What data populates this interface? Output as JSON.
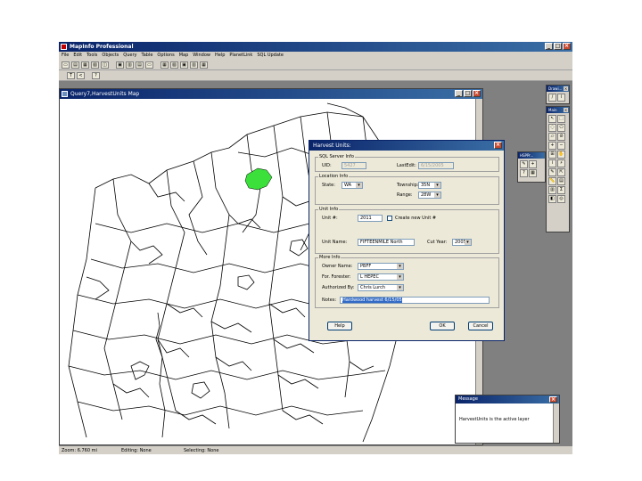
{
  "app": {
    "title": "MapInfo Professional"
  },
  "menu": [
    "File",
    "Edit",
    "Tools",
    "Objects",
    "Query",
    "Table",
    "Options",
    "Map",
    "Window",
    "Help",
    "PlanetLink",
    "SQL Update"
  ],
  "toolbar1": [
    "▭",
    "▤",
    "▦",
    "▧",
    "◫",
    "▣",
    "▥",
    "▤",
    "▭",
    "▦",
    "▧",
    "▣",
    "▥",
    "▦"
  ],
  "toolbar2": [
    "T",
    "<",
    "?"
  ],
  "map_window": {
    "title": "Query7,HarvestUnits Map"
  },
  "dialog": {
    "title": "Harvest Units:",
    "sql_group": "SQL Server Info",
    "uid_label": "UID:",
    "uid_value": "5427",
    "lastedit_label": "LastEdit:",
    "lastedit_value": "6/15/2005",
    "location_group": "Location Info",
    "state_label": "State:",
    "state_value": "WA",
    "township_label": "Township:",
    "township_value": "35N",
    "range_label": "Range:",
    "range_value": "28W",
    "unit_group": "Unit Info",
    "unitnum_label": "Unit #:",
    "unitnum_value": "2011",
    "checkbox_label": "Create new Unit #",
    "unitname_label": "Unit Name:",
    "unitname_value": "FIFTEENMILE North",
    "cutyear_label": "Cut Year:",
    "cutyear_value": "2005",
    "more_group": "More Info",
    "owner_label": "Owner Name:",
    "owner_value": "PBFF",
    "forester_label": "For. Forester:",
    "forester_value": "L HEPEC",
    "authorized_label": "Authorized By:",
    "authorized_value": "Chris Lurch",
    "notes_label": "Notes:",
    "notes_value": "Hardwood harvest 6/15/05",
    "help_btn": "Help",
    "ok_btn": "OK",
    "cancel_btn": "Cancel"
  },
  "palettes": {
    "drawing": "Drawi...",
    "main": "Main",
    "small": "HSPPr..."
  },
  "message": {
    "title": "Message",
    "text": "HarvestUnits is the active layer"
  },
  "status": {
    "zoom": "Zoom: 6.760 mi",
    "editing": "Editing: None",
    "selecting": "Selecting: None"
  },
  "colors": {
    "selected_polygon": "#3be03b",
    "titlebar": "#0a246a"
  }
}
